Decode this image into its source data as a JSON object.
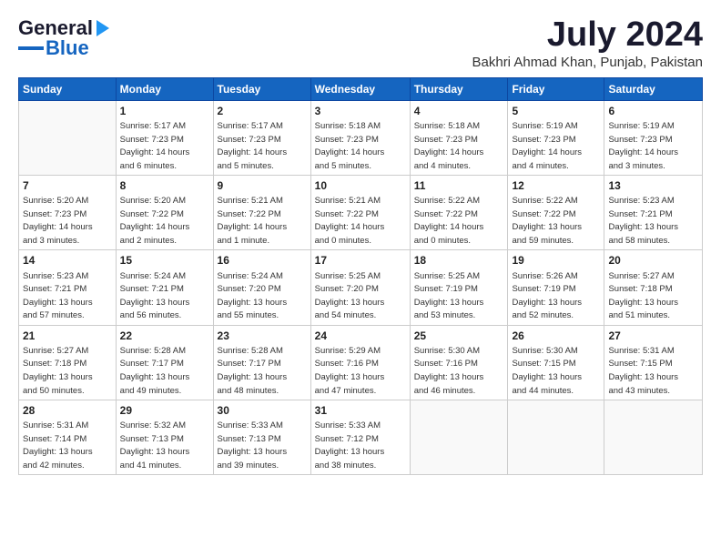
{
  "header": {
    "logo_line1": "General",
    "logo_line2": "Blue",
    "month_title": "July 2024",
    "subtitle": "Bakhri Ahmad Khan, Punjab, Pakistan"
  },
  "weekdays": [
    "Sunday",
    "Monday",
    "Tuesday",
    "Wednesday",
    "Thursday",
    "Friday",
    "Saturday"
  ],
  "weeks": [
    [
      {
        "day": "",
        "info": ""
      },
      {
        "day": "1",
        "info": "Sunrise: 5:17 AM\nSunset: 7:23 PM\nDaylight: 14 hours\nand 6 minutes."
      },
      {
        "day": "2",
        "info": "Sunrise: 5:17 AM\nSunset: 7:23 PM\nDaylight: 14 hours\nand 5 minutes."
      },
      {
        "day": "3",
        "info": "Sunrise: 5:18 AM\nSunset: 7:23 PM\nDaylight: 14 hours\nand 5 minutes."
      },
      {
        "day": "4",
        "info": "Sunrise: 5:18 AM\nSunset: 7:23 PM\nDaylight: 14 hours\nand 4 minutes."
      },
      {
        "day": "5",
        "info": "Sunrise: 5:19 AM\nSunset: 7:23 PM\nDaylight: 14 hours\nand 4 minutes."
      },
      {
        "day": "6",
        "info": "Sunrise: 5:19 AM\nSunset: 7:23 PM\nDaylight: 14 hours\nand 3 minutes."
      }
    ],
    [
      {
        "day": "7",
        "info": "Sunrise: 5:20 AM\nSunset: 7:23 PM\nDaylight: 14 hours\nand 3 minutes."
      },
      {
        "day": "8",
        "info": "Sunrise: 5:20 AM\nSunset: 7:22 PM\nDaylight: 14 hours\nand 2 minutes."
      },
      {
        "day": "9",
        "info": "Sunrise: 5:21 AM\nSunset: 7:22 PM\nDaylight: 14 hours\nand 1 minute."
      },
      {
        "day": "10",
        "info": "Sunrise: 5:21 AM\nSunset: 7:22 PM\nDaylight: 14 hours\nand 0 minutes."
      },
      {
        "day": "11",
        "info": "Sunrise: 5:22 AM\nSunset: 7:22 PM\nDaylight: 14 hours\nand 0 minutes."
      },
      {
        "day": "12",
        "info": "Sunrise: 5:22 AM\nSunset: 7:22 PM\nDaylight: 13 hours\nand 59 minutes."
      },
      {
        "day": "13",
        "info": "Sunrise: 5:23 AM\nSunset: 7:21 PM\nDaylight: 13 hours\nand 58 minutes."
      }
    ],
    [
      {
        "day": "14",
        "info": "Sunrise: 5:23 AM\nSunset: 7:21 PM\nDaylight: 13 hours\nand 57 minutes."
      },
      {
        "day": "15",
        "info": "Sunrise: 5:24 AM\nSunset: 7:21 PM\nDaylight: 13 hours\nand 56 minutes."
      },
      {
        "day": "16",
        "info": "Sunrise: 5:24 AM\nSunset: 7:20 PM\nDaylight: 13 hours\nand 55 minutes."
      },
      {
        "day": "17",
        "info": "Sunrise: 5:25 AM\nSunset: 7:20 PM\nDaylight: 13 hours\nand 54 minutes."
      },
      {
        "day": "18",
        "info": "Sunrise: 5:25 AM\nSunset: 7:19 PM\nDaylight: 13 hours\nand 53 minutes."
      },
      {
        "day": "19",
        "info": "Sunrise: 5:26 AM\nSunset: 7:19 PM\nDaylight: 13 hours\nand 52 minutes."
      },
      {
        "day": "20",
        "info": "Sunrise: 5:27 AM\nSunset: 7:18 PM\nDaylight: 13 hours\nand 51 minutes."
      }
    ],
    [
      {
        "day": "21",
        "info": "Sunrise: 5:27 AM\nSunset: 7:18 PM\nDaylight: 13 hours\nand 50 minutes."
      },
      {
        "day": "22",
        "info": "Sunrise: 5:28 AM\nSunset: 7:17 PM\nDaylight: 13 hours\nand 49 minutes."
      },
      {
        "day": "23",
        "info": "Sunrise: 5:28 AM\nSunset: 7:17 PM\nDaylight: 13 hours\nand 48 minutes."
      },
      {
        "day": "24",
        "info": "Sunrise: 5:29 AM\nSunset: 7:16 PM\nDaylight: 13 hours\nand 47 minutes."
      },
      {
        "day": "25",
        "info": "Sunrise: 5:30 AM\nSunset: 7:16 PM\nDaylight: 13 hours\nand 46 minutes."
      },
      {
        "day": "26",
        "info": "Sunrise: 5:30 AM\nSunset: 7:15 PM\nDaylight: 13 hours\nand 44 minutes."
      },
      {
        "day": "27",
        "info": "Sunrise: 5:31 AM\nSunset: 7:15 PM\nDaylight: 13 hours\nand 43 minutes."
      }
    ],
    [
      {
        "day": "28",
        "info": "Sunrise: 5:31 AM\nSunset: 7:14 PM\nDaylight: 13 hours\nand 42 minutes."
      },
      {
        "day": "29",
        "info": "Sunrise: 5:32 AM\nSunset: 7:13 PM\nDaylight: 13 hours\nand 41 minutes."
      },
      {
        "day": "30",
        "info": "Sunrise: 5:33 AM\nSunset: 7:13 PM\nDaylight: 13 hours\nand 39 minutes."
      },
      {
        "day": "31",
        "info": "Sunrise: 5:33 AM\nSunset: 7:12 PM\nDaylight: 13 hours\nand 38 minutes."
      },
      {
        "day": "",
        "info": ""
      },
      {
        "day": "",
        "info": ""
      },
      {
        "day": "",
        "info": ""
      }
    ]
  ]
}
